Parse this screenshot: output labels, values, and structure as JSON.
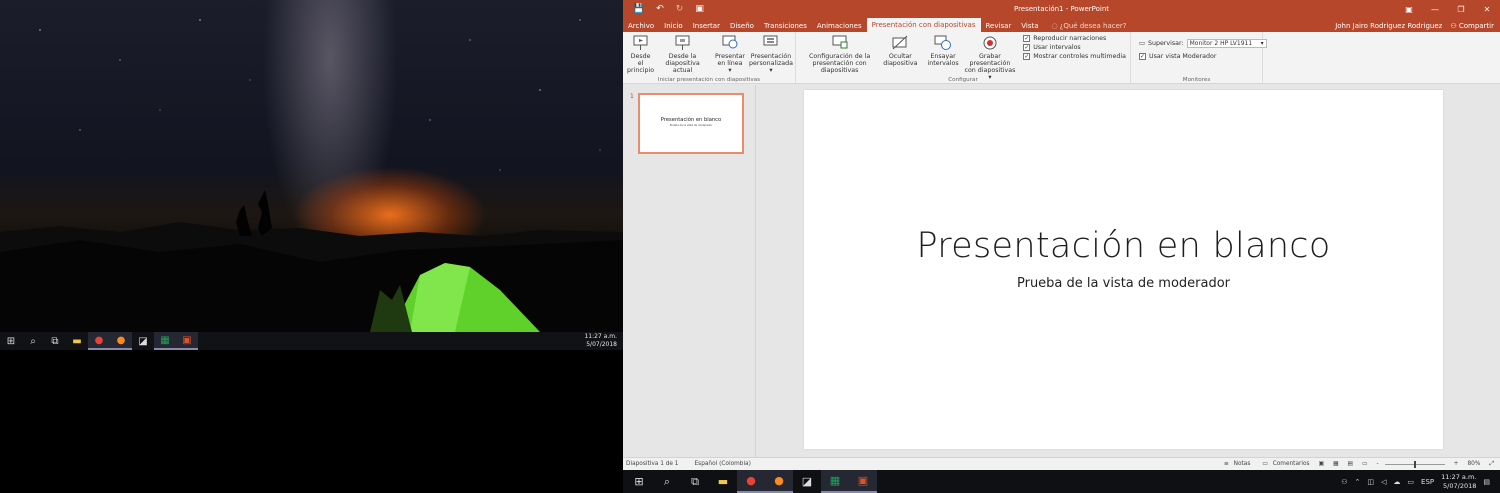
{
  "left_taskbar": {
    "clock_time": "11:27 a.m.",
    "clock_date": "5/07/2018",
    "icons": [
      "windows-start-icon",
      "search-icon",
      "task-view-icon",
      "file-explorer-icon",
      "chrome-icon",
      "firefox-icon",
      "sticky-notes-icon",
      "excel-icon",
      "powerpoint-icon"
    ]
  },
  "window": {
    "title": "Presentación1  -  PowerPoint",
    "qat": {
      "save": "💾",
      "undo": "↶",
      "redo": "↻",
      "start": "▣"
    },
    "controls": {
      "ribbon_opts": "▣",
      "minimize": "—",
      "restore": "❐",
      "close": "✕"
    }
  },
  "tabs": [
    "Archivo",
    "Inicio",
    "Insertar",
    "Diseño",
    "Transiciones",
    "Animaciones",
    "Presentación con diapositivas",
    "Revisar",
    "Vista"
  ],
  "active_tab": "Presentación con diapositivas",
  "tell_me": "¿Qué desea hacer?",
  "user_name": "John Jairo Rodriguez Rodriguez",
  "share_label": "Compartir",
  "ribbon": {
    "group_iniciar": {
      "label": "Iniciar presentación con diapositivas",
      "btn_desde_principio": [
        "Desde el",
        "principio"
      ],
      "btn_desde_actual": [
        "Desde la",
        "diapositiva actual"
      ],
      "btn_presentar_linea": [
        "Presentar",
        "en línea ▾"
      ],
      "btn_personalizada": [
        "Presentación",
        "personalizada ▾"
      ]
    },
    "group_configurar": {
      "label": "Configurar",
      "btn_configuracion": [
        "Configuración de la",
        "presentación con diapositivas"
      ],
      "btn_ocultar": [
        "Ocultar",
        "diapositiva"
      ],
      "btn_ensayar": [
        "Ensayar",
        "intervalos"
      ],
      "btn_grabar": [
        "Grabar presentación",
        "con diapositivas ▾"
      ],
      "chk_narraciones": "Reproducir narraciones",
      "chk_intervalos": "Usar intervalos",
      "chk_controles": "Mostrar controles multimedia"
    },
    "group_monitores": {
      "label": "Monitores",
      "supervisar_label": "Supervisar:",
      "supervisar_value": "Monitor 2 HP LV1911",
      "chk_moderador": "Usar vista Moderador"
    }
  },
  "thumbnail": {
    "number": "1",
    "title": "Presentación en blanco",
    "subtitle": "Prueba de la vista de moderador"
  },
  "slide": {
    "title": "Presentación en blanco",
    "subtitle": "Prueba de la vista de moderador"
  },
  "status": {
    "slide_count": "Diapositiva 1 de 1",
    "language": "Español (Colombia)",
    "notes": "Notas",
    "comments": "Comentarios",
    "zoom_minus": "-",
    "zoom_plus": "+",
    "zoom": "80%",
    "zoom_fraction": 0.5
  },
  "right_taskbar": {
    "clock_time": "11:27 a.m.",
    "clock_date": "5/07/2018",
    "language": "ESP",
    "tray": [
      "people-icon",
      "chevron-up-icon",
      "network-icon",
      "volume-icon",
      "onedrive-icon",
      "battery-icon"
    ]
  }
}
